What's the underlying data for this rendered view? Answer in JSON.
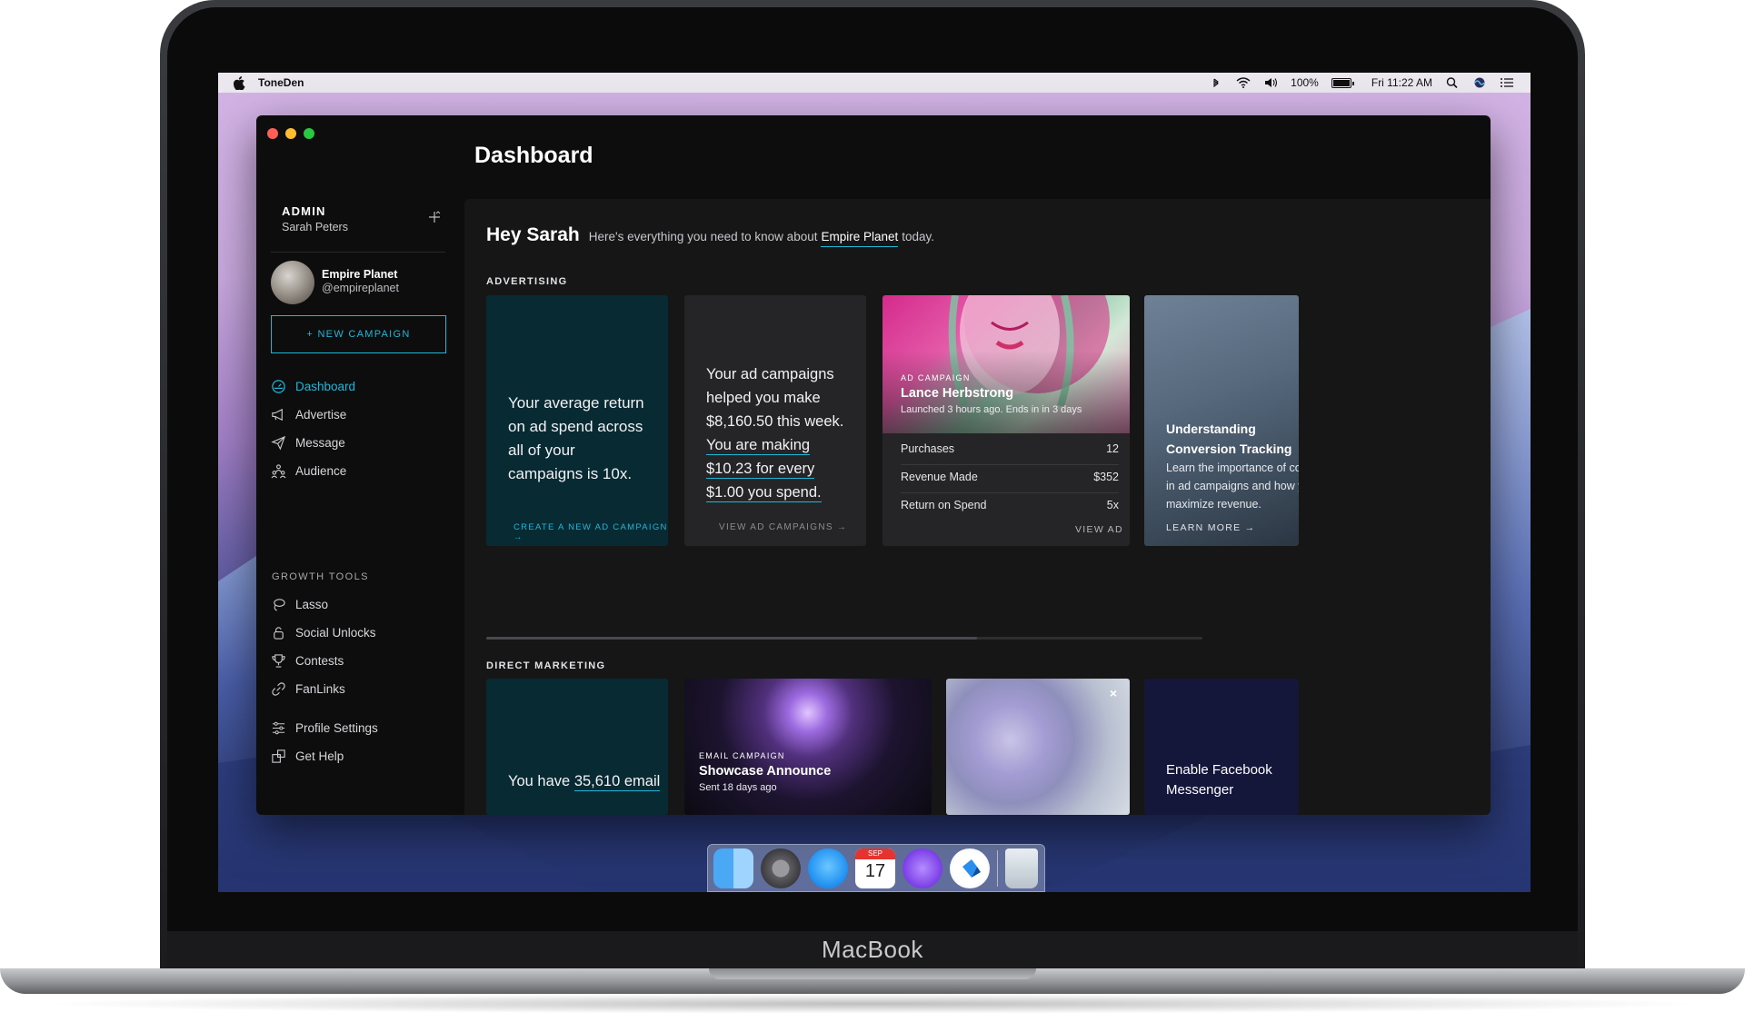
{
  "device": {
    "brand": "MacBook"
  },
  "menubar": {
    "app_name": "ToneDen",
    "battery": "100%",
    "clock": "Fri 11:22 AM",
    "icons": [
      "apple-icon",
      "bluetooth-icon",
      "wifi-icon",
      "volume-icon",
      "battery-icon",
      "spotlight-search-icon",
      "siri-icon",
      "notification-center-icon"
    ]
  },
  "app": {
    "page_title": "Dashboard",
    "accent_color": "#1fb7d8"
  },
  "sidebar": {
    "admin_label": "ADMIN",
    "admin_name": "Sarah Peters",
    "profile_name": "Empire Planet",
    "profile_handle": "@empireplanet",
    "new_campaign_label": "+ NEW CAMPAIGN",
    "nav": [
      {
        "label": "Dashboard",
        "icon": "dashboard-icon",
        "active": true
      },
      {
        "label": "Advertise",
        "icon": "megaphone-icon"
      },
      {
        "label": "Message",
        "icon": "paper-plane-icon"
      },
      {
        "label": "Audience",
        "icon": "audience-icon"
      }
    ],
    "growth_tools_label": "GROWTH TOOLS",
    "growth_tools": [
      {
        "label": "Lasso",
        "icon": "lasso-icon"
      },
      {
        "label": "Social Unlocks",
        "icon": "lock-icon"
      },
      {
        "label": "Contests",
        "icon": "trophy-icon"
      },
      {
        "label": "FanLinks",
        "icon": "link-icon"
      }
    ],
    "footer": [
      {
        "label": "Profile Settings",
        "icon": "sliders-icon"
      },
      {
        "label": "Get Help",
        "icon": "help-icon"
      }
    ]
  },
  "main": {
    "greeting": "Hey Sarah",
    "greeting_sub": "Here's everything you need to know about",
    "greeting_org": "Empire Planet",
    "greeting_today": "today.",
    "advertising_label": "ADVERTISING",
    "direct_marketing_label": "DIRECT MARKETING",
    "roas_card": {
      "text": "Your average return on ad spend across all of your campaigns is 10x.",
      "link": "CREATE A NEW AD CAMPAIGN →"
    },
    "earnings_card": {
      "line1": "Your ad campaigns helped you make $8,160.50 this week.",
      "line2": "You are making $10.23 for every $1.00 you spend.",
      "link": "VIEW AD CAMPAIGNS →"
    },
    "ad_campaign": {
      "kicker": "AD CAMPAIGN",
      "title": "Lance Herbstrong",
      "meta": "Launched 3 hours ago. Ends in in 3 days",
      "rows": [
        {
          "label": "Purchases",
          "value": "12"
        },
        {
          "label": "Revenue Made",
          "value": "$352"
        },
        {
          "label": "Return on Spend",
          "value": "5x"
        }
      ],
      "link": "VIEW AD"
    },
    "learn_card": {
      "title_line1": "Understanding",
      "title_line2": "Conversion Tracking",
      "body": "Learn the importance of conversion tracking in ad campaigns and how you can use it to maximize revenue.",
      "link": "LEARN MORE →"
    },
    "email_stat": {
      "prefix": "You have",
      "count": "35,610 email"
    },
    "email_campaign": {
      "kicker": "EMAIL CAMPAIGN",
      "title": "Showcase Announce",
      "meta": "Sent 18 days ago"
    },
    "promo_close": "×",
    "fb_card": {
      "line1": "Enable Facebook",
      "line2": "Messenger"
    }
  },
  "dock": {
    "apps": [
      "finder-icon",
      "system-preferences-icon",
      "messages-icon",
      "calendar-icon",
      "podcasts-icon",
      "toneden-icon",
      "trash-icon"
    ],
    "calendar_month": "SEP",
    "calendar_day": "17"
  }
}
